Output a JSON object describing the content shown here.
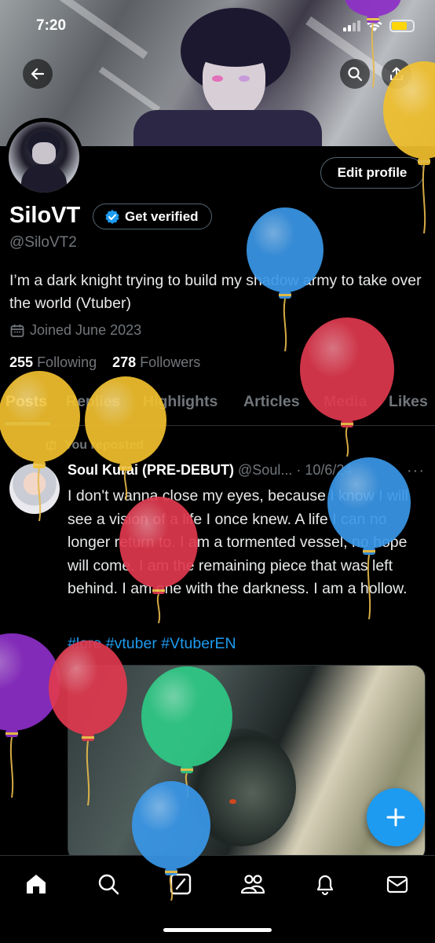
{
  "status_bar": {
    "time": "7:20"
  },
  "profile": {
    "display_name": "SiloVT",
    "verify_label": "Get verified",
    "handle": "@SiloVT2",
    "bio": "I’m a dark knight trying to build my shadow army to take over the world (Vtuber)",
    "joined": "Joined June 2023",
    "following_count": "255",
    "following_label": "Following",
    "followers_count": "278",
    "followers_label": "Followers",
    "edit_label": "Edit profile"
  },
  "tabs": [
    {
      "label": "Posts",
      "active": true
    },
    {
      "label": "Replies"
    },
    {
      "label": "Highlights"
    },
    {
      "label": "Articles"
    },
    {
      "label": "Media"
    },
    {
      "label": "Likes"
    }
  ],
  "post": {
    "repost_label": "You reposted",
    "author": "Soul Kurai (PRE-DEBUT)",
    "username": "@Soul...",
    "date": "10/6/24",
    "more": "···",
    "text": "I don't wanna close my eyes, because I know I will see a vision of a life I once knew. A life I can no longer return to. I am a tormented vessel, no hope will come. I am the remaining piece that was left behind. I am one with the darkness. I am a hollow.",
    "hashtags": "#lore #vtuber #VtuberEN"
  },
  "colors": {
    "accent": "#1d9bf0",
    "balloon_blue": "#3a97e8",
    "balloon_red": "#e0394f",
    "balloon_yellow": "#f2c12e",
    "balloon_purple": "#8e2fc8",
    "balloon_green": "#2ec985"
  },
  "icons": {
    "back": "arrow-left-icon",
    "search": "search-icon",
    "share": "share-icon",
    "verified": "verified-badge-icon",
    "calendar": "calendar-icon",
    "repost": "repost-icon",
    "compose": "plus-icon",
    "nav": [
      "home-icon",
      "search-icon",
      "grok-icon",
      "communities-icon",
      "bell-icon",
      "mail-icon"
    ]
  }
}
